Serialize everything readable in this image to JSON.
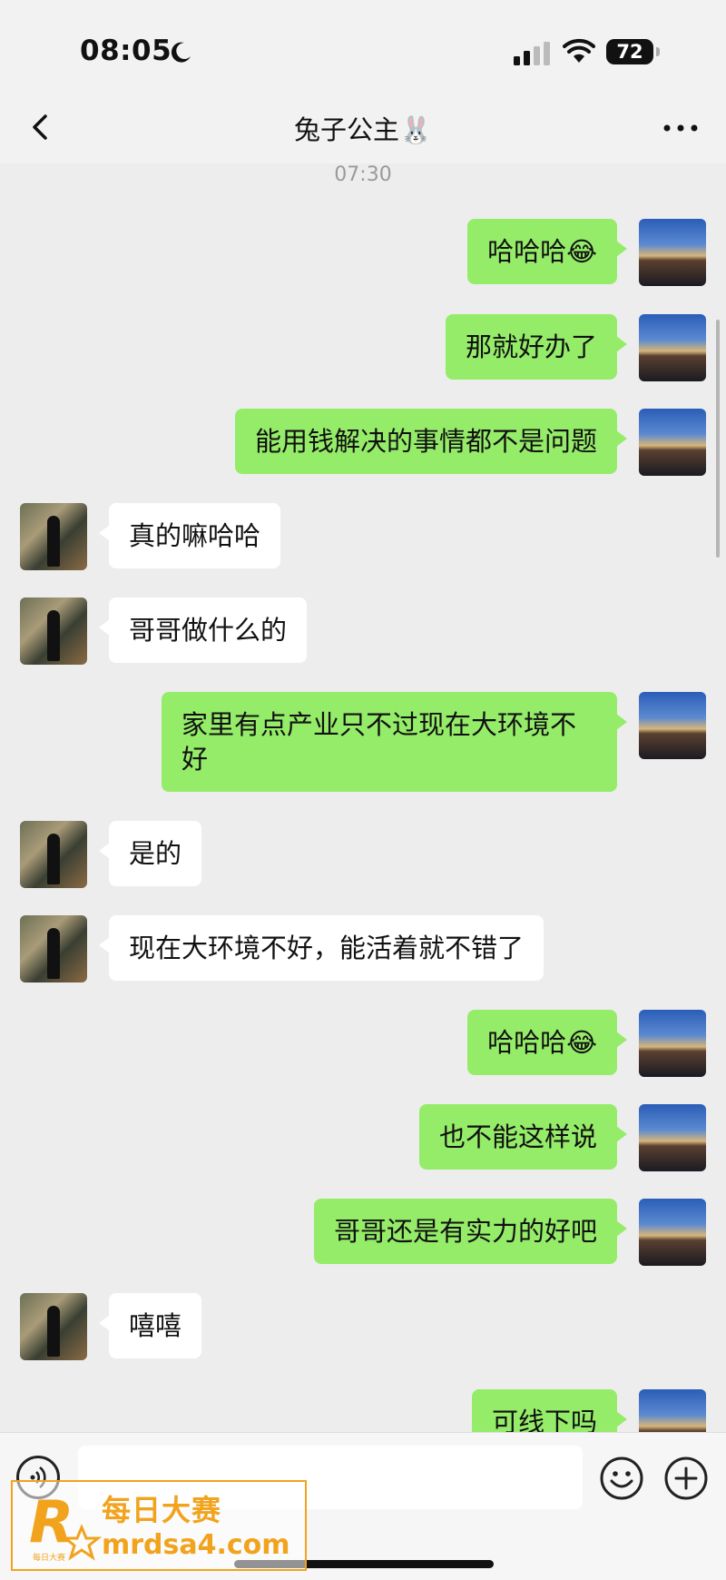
{
  "status_bar": {
    "time": "08:05",
    "battery": "72"
  },
  "nav": {
    "title": "兔子公主🐰"
  },
  "timestamp": "07:30",
  "messages": [
    {
      "from": "me",
      "text": "哈哈哈😂"
    },
    {
      "from": "me",
      "text": "那就好办了"
    },
    {
      "from": "me",
      "text": "能用钱解决的事情都不是问题"
    },
    {
      "from": "her",
      "text": "真的嘛哈哈"
    },
    {
      "from": "her",
      "text": "哥哥做什么的"
    },
    {
      "from": "me",
      "text": "家里有点产业只不过现在大环境不好"
    },
    {
      "from": "her",
      "text": "是的"
    },
    {
      "from": "her",
      "text": "现在大环境不好，能活着就不错了"
    },
    {
      "from": "me",
      "text": "哈哈哈😂"
    },
    {
      "from": "me",
      "text": "也不能这样说"
    },
    {
      "from": "me",
      "text": "哥哥还是有实力的好吧"
    },
    {
      "from": "her",
      "text": "嘻嘻"
    },
    {
      "from": "me",
      "text": "可线下吗"
    }
  ],
  "watermark": {
    "cn": "每日大赛",
    "url": "mrdsa4.com",
    "logo_letter": "R",
    "logo_small": "每日大赛"
  },
  "icons": [
    "back-icon",
    "more-icon",
    "voice-icon",
    "emoji-icon",
    "plus-icon",
    "moon-icon",
    "signal-icon",
    "wifi-icon"
  ]
}
